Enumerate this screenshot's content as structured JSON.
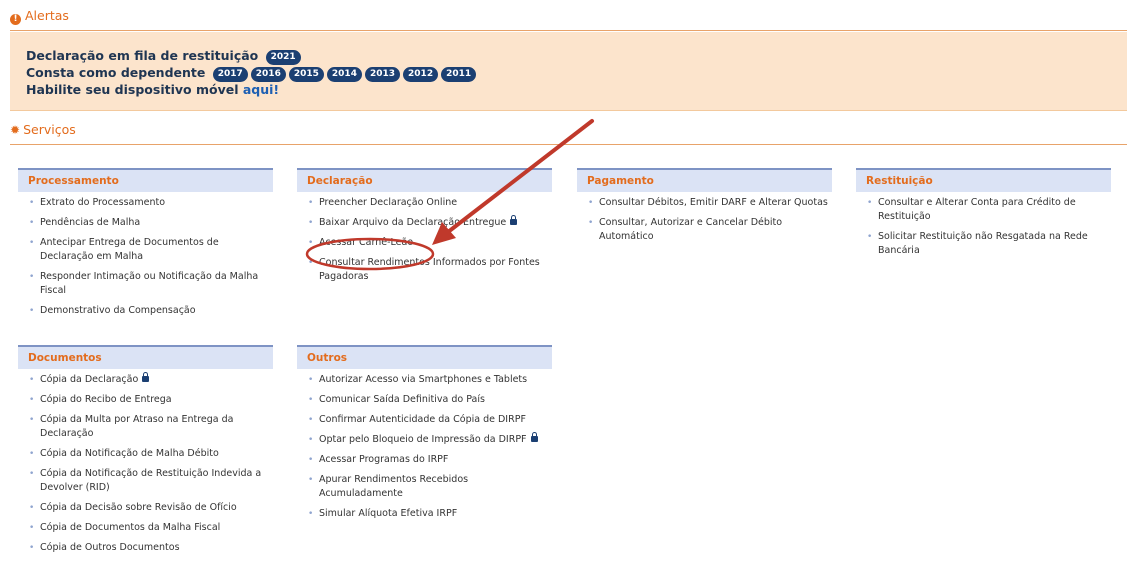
{
  "alerts": {
    "title": "Alertas",
    "line1": {
      "text": "Declaração em fila de restituição",
      "badges": [
        "2021"
      ]
    },
    "line2": {
      "text": "Consta como dependente",
      "badges": [
        "2017",
        "2016",
        "2015",
        "2014",
        "2013",
        "2012",
        "2011"
      ]
    },
    "line3": {
      "text": "Habilite seu dispositivo móvel",
      "link": "aqui!"
    }
  },
  "services": {
    "title": "Serviços",
    "processamento": {
      "title": "Processamento",
      "items": [
        "Extrato do Processamento",
        "Pendências de Malha",
        "Antecipar Entrega de Documentos de Declaração em Malha",
        "Responder Intimação ou Notificação da Malha Fiscal",
        "Demonstrativo da Compensação"
      ]
    },
    "declaracao": {
      "title": "Declaração",
      "items": [
        "Preencher Declaração Online",
        "Baixar Arquivo da Declaração Entregue",
        "Acessar Carnê-Leão",
        "Consultar Rendimentos Informados por Fontes Pagadoras"
      ]
    },
    "pagamento": {
      "title": "Pagamento",
      "items": [
        "Consultar Débitos, Emitir DARF e Alterar Quotas",
        "Consultar, Autorizar e Cancelar Débito Automático"
      ]
    },
    "restituicao": {
      "title": "Restituição",
      "items": [
        "Consultar e Alterar Conta para Crédito de Restituição",
        "Solicitar Restituição não Resgatada na Rede Bancária"
      ]
    },
    "documentos": {
      "title": "Documentos",
      "items": [
        "Cópia da Declaração",
        "Cópia do Recibo de Entrega",
        "Cópia da Multa por Atraso na Entrega da Declaração",
        "Cópia da Notificação de Malha Débito",
        "Cópia da Notificação de Restituição Indevida a Devolver (RID)",
        "Cópia da Decisão sobre Revisão de Ofício",
        "Cópia de Documentos da Malha Fiscal",
        "Cópia de Outros Documentos"
      ]
    },
    "outros": {
      "title": "Outros",
      "items": [
        "Autorizar Acesso via Smartphones e Tablets",
        "Comunicar Saída Definitiva do País",
        "Confirmar Autenticidade da Cópia de DIRPF",
        "Optar pelo Bloqueio de Impressão da DIRPF",
        "Acessar Programas do IRPF",
        "Apurar Rendimentos Recebidos Acumuladamente",
        "Simular Alíquota Efetiva IRPF"
      ]
    }
  },
  "colors": {
    "accent": "#e36c1d",
    "badge": "#1b3f72",
    "box_header": "#dbe3f5",
    "alert_bg": "#fce4cc",
    "annotation": "#c0392b"
  },
  "icons": {
    "alerts": "exclamation-circle-icon",
    "services": "gear-icon",
    "lock": "lock-icon",
    "annotation_arrow": "arrow-icon",
    "annotation_circle": "highlight-circle"
  }
}
